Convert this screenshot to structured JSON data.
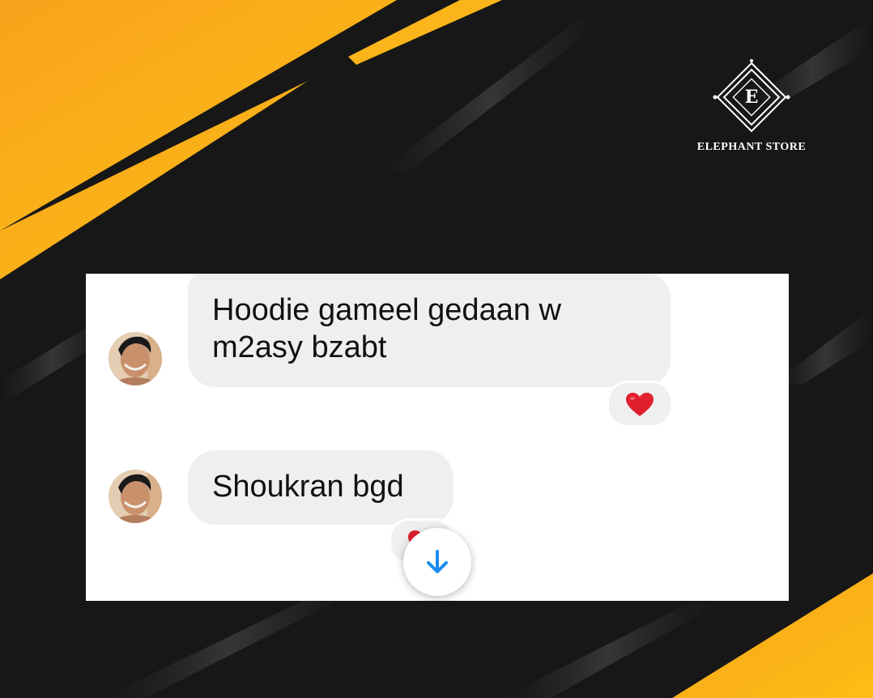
{
  "brand": {
    "logo_letter": "E",
    "name": "ELEPHANT STORE",
    "accent_color": "#f7a21b",
    "background_color": "#171717"
  },
  "chat": {
    "messages": [
      {
        "text": "Hoodie gameel gedaan w m2asy bzabt",
        "reaction": "heart-icon"
      },
      {
        "text": "Shoukran bgd",
        "reaction": "heart-icon"
      }
    ],
    "bubble_color": "#efefef",
    "scroll_button_icon": "arrow-down-icon",
    "scroll_button_color": "#1a8cf0"
  }
}
